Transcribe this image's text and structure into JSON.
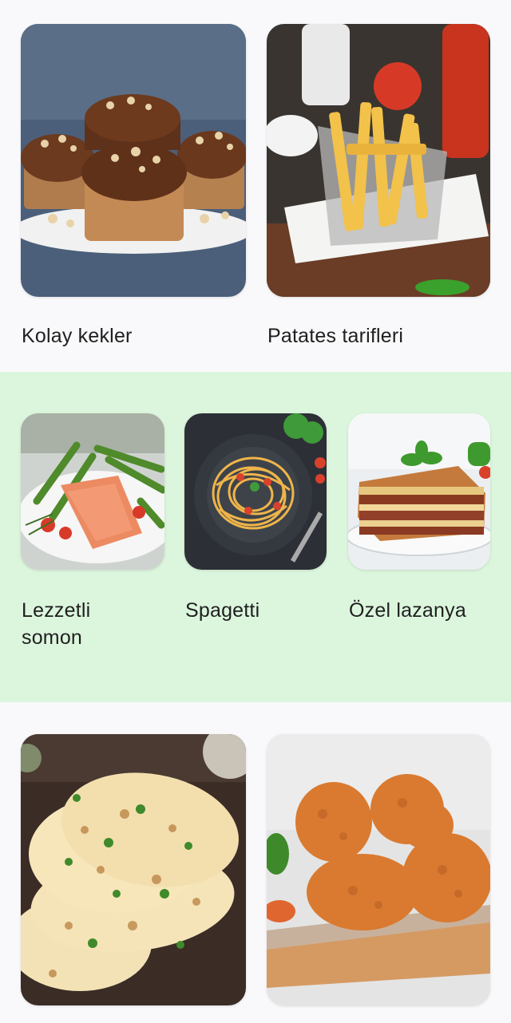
{
  "theme": {
    "mint_background": "#dcf6dd",
    "page_background": "#f9f9fb",
    "text_color": "#1f1f1f"
  },
  "sections": [
    {
      "cards": [
        {
          "label": "Kolay kekler",
          "image": "muffins-image"
        },
        {
          "label": "Patates tarifleri",
          "image": "french-fries-image"
        }
      ]
    },
    {
      "cards": [
        {
          "label": "Lezzetli somon",
          "image": "salmon-image"
        },
        {
          "label": "Spagetti",
          "image": "spaghetti-image"
        },
        {
          "label": "Özel lazanya",
          "image": "lasagna-image"
        }
      ]
    },
    {
      "cards": [
        {
          "image": "naan-bread-image"
        },
        {
          "image": "fried-chicken-image"
        }
      ]
    }
  ]
}
